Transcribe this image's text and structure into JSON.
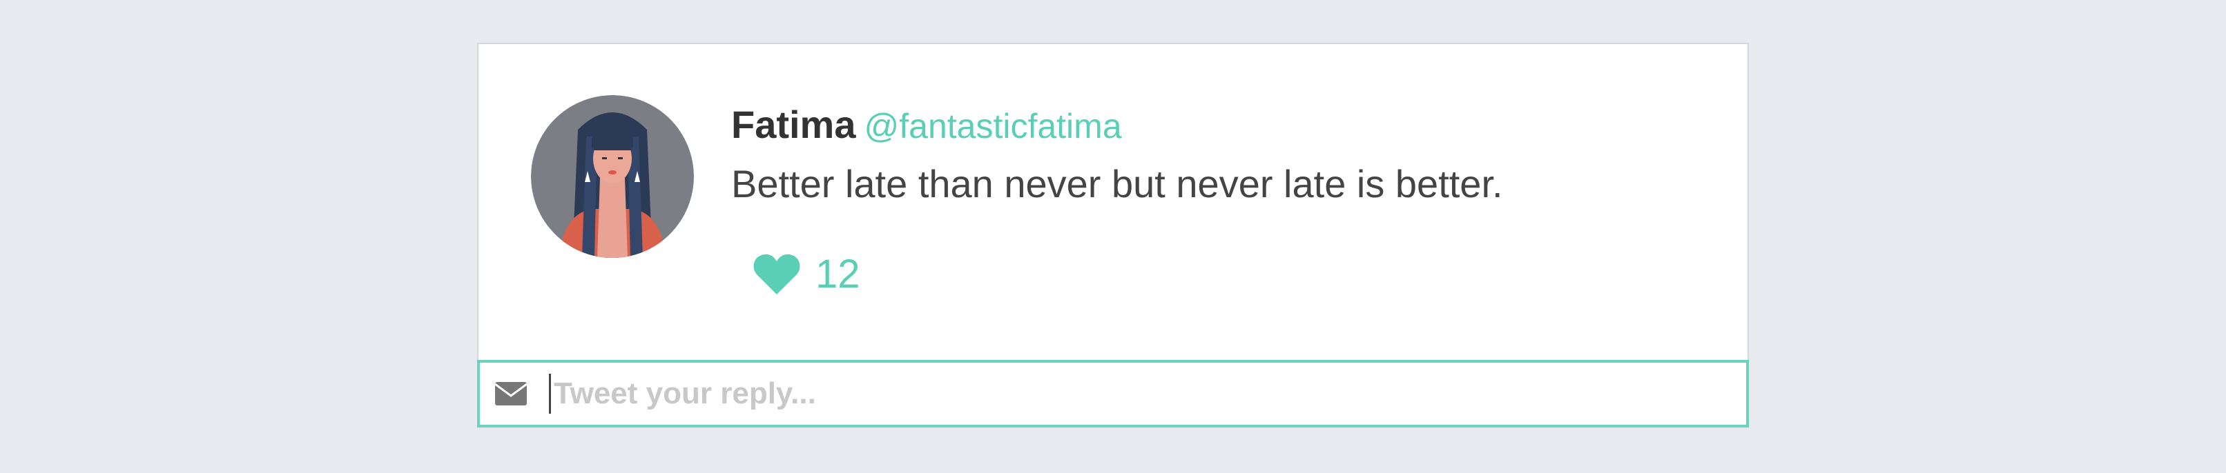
{
  "tweet": {
    "author_name": "Fatima",
    "author_handle": "@fantasticfatima",
    "text": "Better late than never but never late is better.",
    "likes": "12",
    "avatar_icon": "woman-avatar-illustration"
  },
  "reply": {
    "placeholder": "Tweet your reply...",
    "value": "",
    "icon": "envelope-icon"
  },
  "colors": {
    "accent": "#5bcfb5",
    "background": "#e7ebef",
    "card": "#ffffff",
    "text": "#444444"
  }
}
